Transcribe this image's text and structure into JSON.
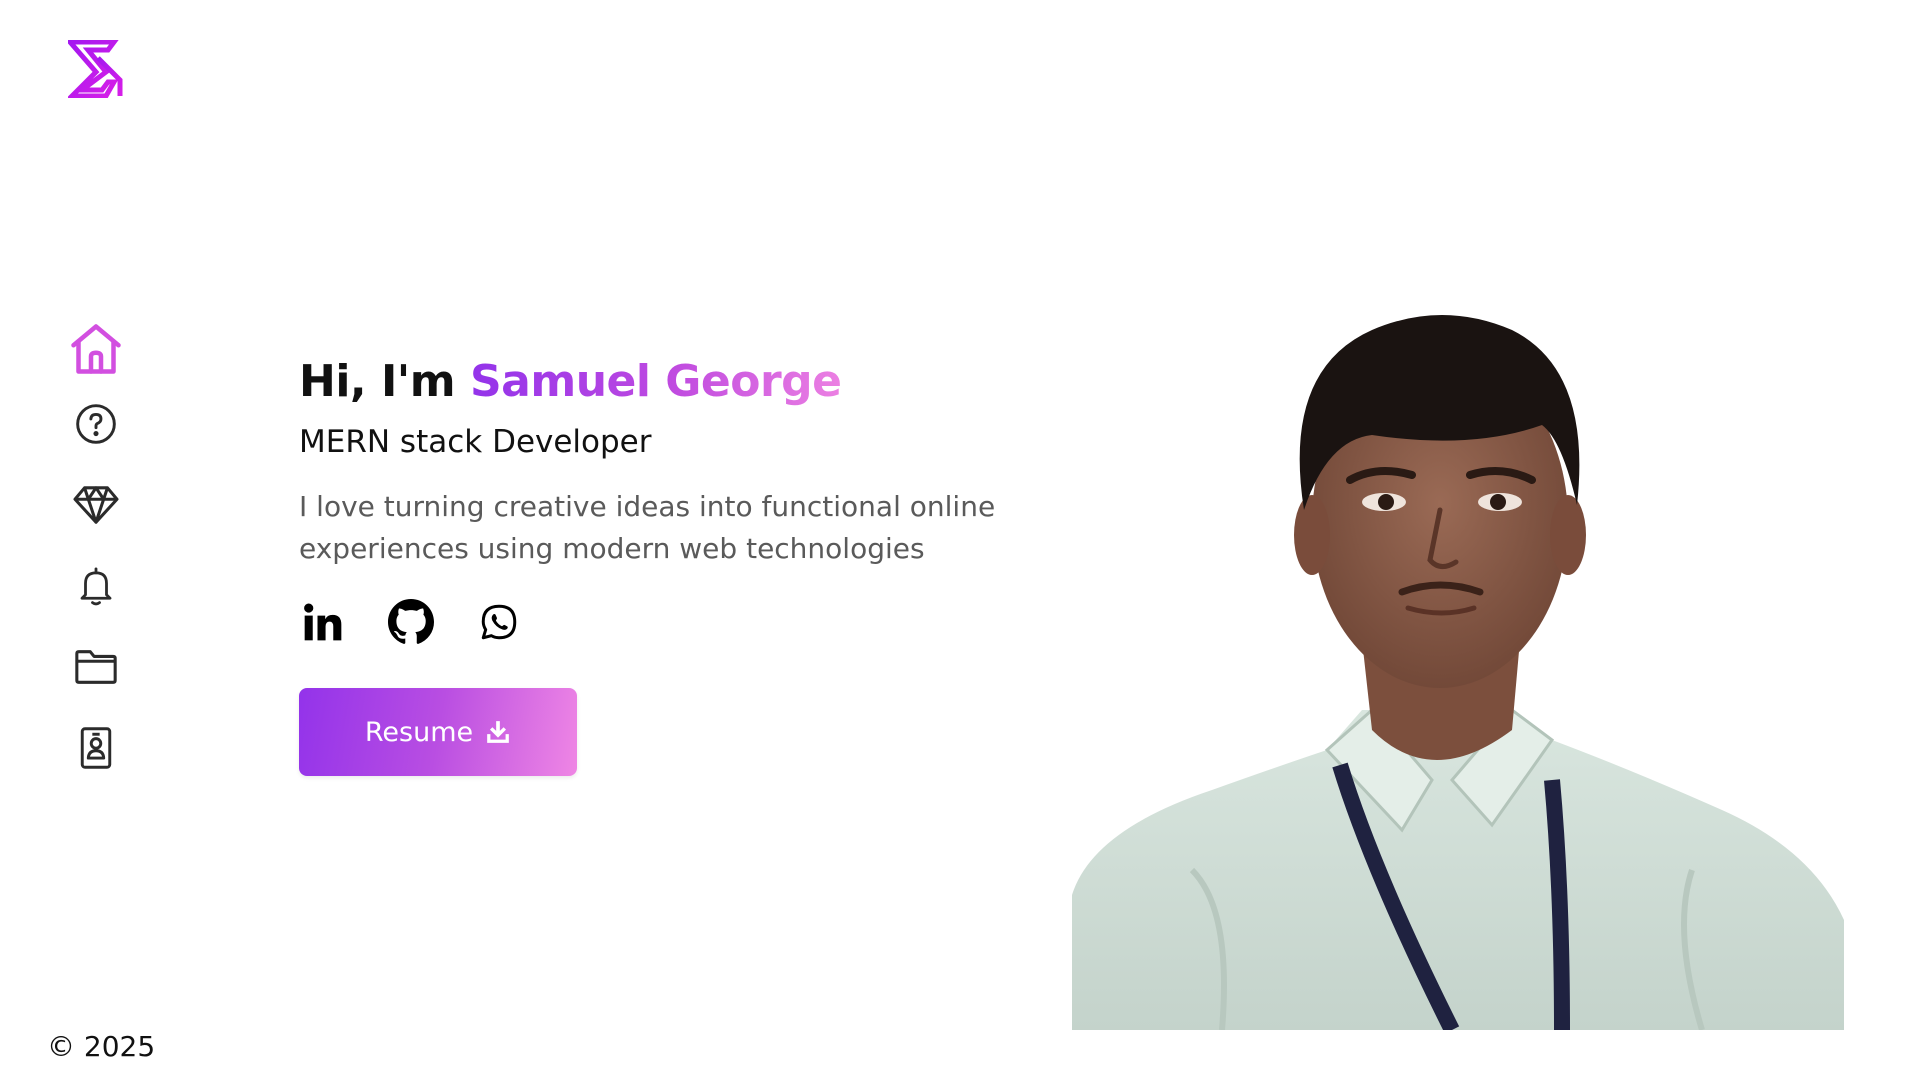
{
  "logo": {
    "icon": "brand-logo-icon",
    "color": "#c21cf0"
  },
  "sidebar": {
    "items": [
      {
        "icon": "home-icon",
        "active": true
      },
      {
        "icon": "question-circle-icon",
        "active": false
      },
      {
        "icon": "diamond-icon",
        "active": false
      },
      {
        "icon": "bell-icon",
        "active": false
      },
      {
        "icon": "folder-icon",
        "active": false
      },
      {
        "icon": "contact-card-icon",
        "active": false
      }
    ],
    "active_color": "#d24fe0",
    "inactive_color": "#2b2b2b"
  },
  "hero": {
    "greeting_prefix": "Hi, I'm",
    "name": "Samuel George",
    "role": "MERN stack Developer",
    "tagline": "I love turning creative ideas into functional online experiences using modern web technologies",
    "socials": [
      {
        "icon": "linkedin-icon"
      },
      {
        "icon": "github-icon"
      },
      {
        "icon": "whatsapp-icon"
      }
    ],
    "resume_button": {
      "label": "Resume",
      "icon": "download-icon"
    },
    "accent_gradient": [
      "#9333ea",
      "#ef86e4"
    ]
  },
  "portrait": {
    "icon": "profile-photo"
  },
  "footer": {
    "copyright": "© 2025"
  }
}
